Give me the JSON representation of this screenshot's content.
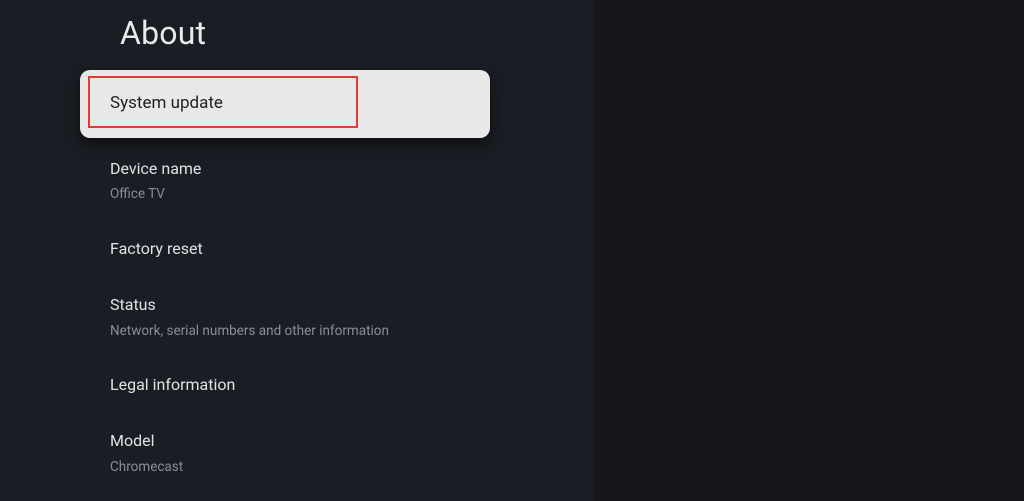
{
  "page": {
    "title": "About"
  },
  "menu": {
    "items": [
      {
        "title": "System update",
        "subtitle": ""
      },
      {
        "title": "Device name",
        "subtitle": "Office TV"
      },
      {
        "title": "Factory reset",
        "subtitle": ""
      },
      {
        "title": "Status",
        "subtitle": "Network, serial numbers and other information"
      },
      {
        "title": "Legal information",
        "subtitle": ""
      },
      {
        "title": "Model",
        "subtitle": "Chromecast"
      }
    ]
  }
}
